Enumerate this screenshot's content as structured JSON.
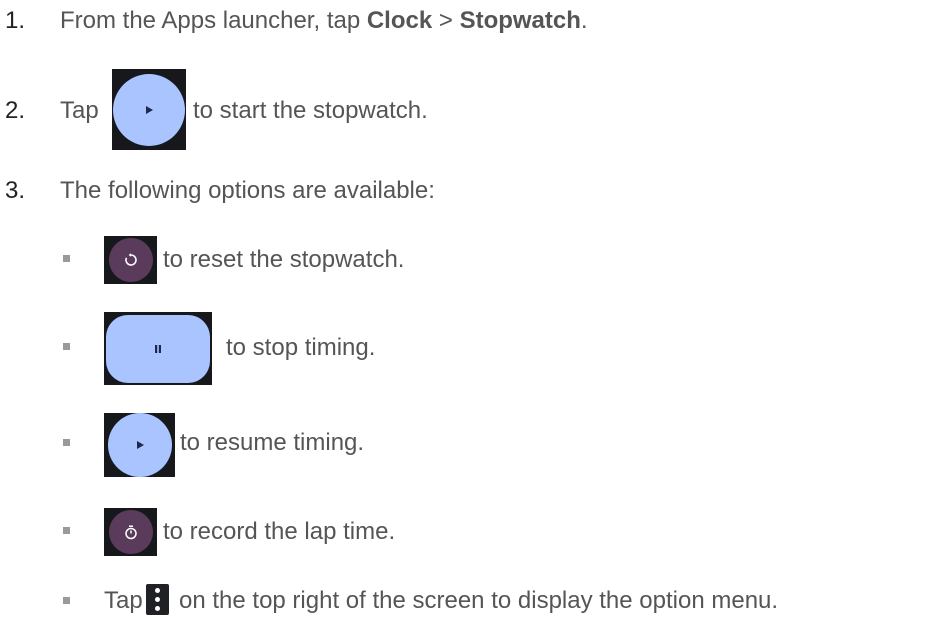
{
  "steps": [
    {
      "number": "1.",
      "parts": {
        "pre": "From the Apps launcher, tap ",
        "bold1": "Clock",
        "sep": " > ",
        "bold2": "Stopwatch",
        "post": "."
      }
    },
    {
      "number": "2.",
      "pre": "Tap",
      "icon": "play-icon",
      "post": "to start the stopwatch."
    },
    {
      "number": "3.",
      "text": "The following options are available:"
    }
  ],
  "options": [
    {
      "icon": "reset-icon",
      "text": "to reset the stopwatch."
    },
    {
      "icon": "pause-icon",
      "text": "to stop timing."
    },
    {
      "icon": "play-icon",
      "text": "to resume timing."
    },
    {
      "icon": "lap-timer-icon",
      "text": "to record the lap time."
    },
    {
      "pre": "Tap",
      "icon": "more-vert-icon",
      "text": "on the top right of the screen to display the option menu."
    }
  ],
  "colors": {
    "text": "#555555",
    "number": "#222222",
    "play_button": "#aac4ff",
    "secondary_button": "#5a3b5c",
    "icon_background": "#16181c"
  }
}
